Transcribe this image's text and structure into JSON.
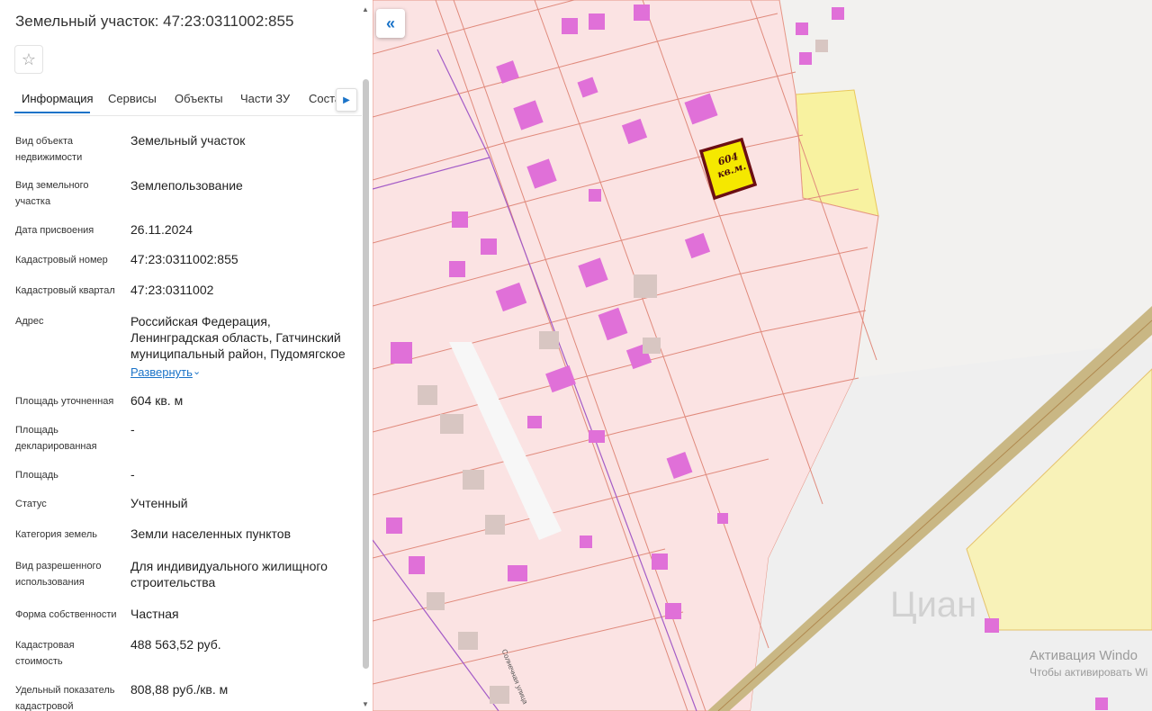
{
  "panel": {
    "title": "Земельный участок: 47:23:0311002:855",
    "tabs": [
      "Информация",
      "Сервисы",
      "Объекты",
      "Части ЗУ",
      "Состав"
    ],
    "rows": [
      {
        "label": "Вид объекта недвижимости",
        "value": "Земельный участок"
      },
      {
        "label": "Вид земельного участка",
        "value": "Землепользование"
      },
      {
        "label": "Дата присвоения",
        "value": "26.11.2024"
      },
      {
        "label": "Кадастровый номер",
        "value": "47:23:0311002:855"
      },
      {
        "label": "Кадастровый квартал",
        "value": "47:23:0311002"
      },
      {
        "label": "Адрес",
        "value": "Российская Федерация, Ленинградская область, Гатчинский муниципальный район, Пудомягское"
      },
      {
        "label": "Площадь уточненная",
        "value": "604 кв. м"
      },
      {
        "label": "Площадь декларированная",
        "value": "-"
      },
      {
        "label": "Площадь",
        "value": "-"
      },
      {
        "label": "Статус",
        "value": "Учтенный"
      },
      {
        "label": "Категория земель",
        "value": "Земли населенных пунктов"
      },
      {
        "label": "Вид разрешенного использования",
        "value": "Для индивидуального жилищного строительства"
      },
      {
        "label": "Форма собственности",
        "value": "Частная"
      },
      {
        "label": "Кадастровая стоимость",
        "value": "488 563,52 руб."
      },
      {
        "label": "Удельный показатель кадастровой",
        "value": "808,88 руб./кв. м"
      }
    ],
    "expand_label": "Развернуть"
  },
  "map": {
    "area_label_line1": "604",
    "area_label_line2": "кв.м.",
    "street_label": "Солнечная улица",
    "watermark_logo": "Циан",
    "activation_line1": "Активация Windo",
    "activation_line2": "Чтобы активировать Wi"
  },
  "icons": {
    "star": "star-icon",
    "collapse": "double-chevron-left-icon",
    "tab_next": "chevron-right-icon",
    "expand": "chevron-down-icon"
  },
  "colors": {
    "accent": "#1a73c8",
    "parcel_fill": "#fbe3e3",
    "parcel_line": "#e07a6a",
    "building": "#e070d8",
    "selected_fill": "#f5e800",
    "selected_border": "#6b0f14",
    "zone_yellow": "#f8f2a0",
    "road": "#c9b784"
  }
}
